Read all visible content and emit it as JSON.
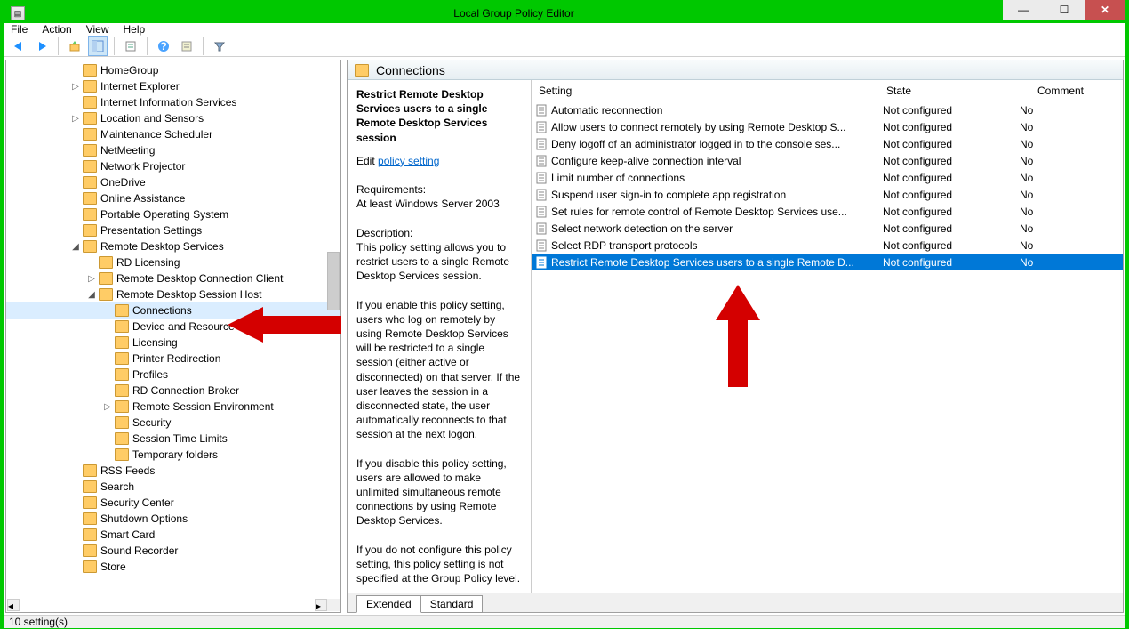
{
  "window": {
    "title": "Local Group Policy Editor"
  },
  "menu": {
    "file": "File",
    "action": "Action",
    "view": "View",
    "help": "Help"
  },
  "toolbar_icons": [
    "back-icon",
    "forward-icon",
    "up-icon",
    "show-hide-tree-icon",
    "export-list-icon",
    "help-icon",
    "properties-icon",
    "filter-icon"
  ],
  "header": {
    "title": "Connections"
  },
  "detail": {
    "title": "Restrict Remote Desktop Services users to a single Remote Desktop Services session",
    "edit_prefix": "Edit",
    "edit_link": "policy setting",
    "req_label": "Requirements:",
    "req_text": "At least Windows Server 2003",
    "desc_label": "Description:",
    "desc1": "This policy setting allows you to restrict users to a single Remote Desktop Services session.",
    "desc2": "If you enable this policy setting, users who log on remotely by using Remote Desktop Services will be restricted to a single session (either active or disconnected) on that server. If the user leaves the session in a disconnected state, the user automatically reconnects to that session at the next logon.",
    "desc3": "If you disable this policy setting, users are allowed to make unlimited simultaneous remote connections by using Remote Desktop Services.",
    "desc4": "If you do not configure this policy setting,  this policy setting is not specified at the Group Policy level."
  },
  "columns": {
    "setting": "Setting",
    "state": "State",
    "comment": "Comment"
  },
  "settings": [
    {
      "name": "Automatic reconnection",
      "state": "Not configured",
      "comment": "No"
    },
    {
      "name": "Allow users to connect remotely by using Remote Desktop S...",
      "state": "Not configured",
      "comment": "No"
    },
    {
      "name": "Deny logoff of an administrator logged in to the console ses...",
      "state": "Not configured",
      "comment": "No"
    },
    {
      "name": "Configure keep-alive connection interval",
      "state": "Not configured",
      "comment": "No"
    },
    {
      "name": "Limit number of connections",
      "state": "Not configured",
      "comment": "No"
    },
    {
      "name": "Suspend user sign-in to complete app registration",
      "state": "Not configured",
      "comment": "No"
    },
    {
      "name": "Set rules for remote control of Remote Desktop Services use...",
      "state": "Not configured",
      "comment": "No"
    },
    {
      "name": "Select network detection on the server",
      "state": "Not configured",
      "comment": "No"
    },
    {
      "name": "Select RDP transport protocols",
      "state": "Not configured",
      "comment": "No"
    },
    {
      "name": "Restrict Remote Desktop Services users to a single Remote D...",
      "state": "Not configured",
      "comment": "No",
      "selected": true
    }
  ],
  "tabs": {
    "extended": "Extended",
    "standard": "Standard"
  },
  "status": "10 setting(s)",
  "tree": [
    {
      "label": "HomeGroup",
      "indent": 4
    },
    {
      "label": "Internet Explorer",
      "indent": 4,
      "caret": "right"
    },
    {
      "label": "Internet Information Services",
      "indent": 4
    },
    {
      "label": "Location and Sensors",
      "indent": 4,
      "caret": "right"
    },
    {
      "label": "Maintenance Scheduler",
      "indent": 4
    },
    {
      "label": "NetMeeting",
      "indent": 4
    },
    {
      "label": "Network Projector",
      "indent": 4
    },
    {
      "label": "OneDrive",
      "indent": 4
    },
    {
      "label": "Online Assistance",
      "indent": 4
    },
    {
      "label": "Portable Operating System",
      "indent": 4
    },
    {
      "label": "Presentation Settings",
      "indent": 4
    },
    {
      "label": "Remote Desktop Services",
      "indent": 4,
      "caret": "down"
    },
    {
      "label": "RD Licensing",
      "indent": 5
    },
    {
      "label": "Remote Desktop Connection Client",
      "indent": 5,
      "caret": "right"
    },
    {
      "label": "Remote Desktop Session Host",
      "indent": 5,
      "caret": "down"
    },
    {
      "label": "Connections",
      "indent": 6,
      "sel": true
    },
    {
      "label": "Device and Resource Redirection",
      "indent": 6
    },
    {
      "label": "Licensing",
      "indent": 6
    },
    {
      "label": "Printer Redirection",
      "indent": 6
    },
    {
      "label": "Profiles",
      "indent": 6
    },
    {
      "label": "RD Connection Broker",
      "indent": 6
    },
    {
      "label": "Remote Session Environment",
      "indent": 6,
      "caret": "right"
    },
    {
      "label": "Security",
      "indent": 6
    },
    {
      "label": "Session Time Limits",
      "indent": 6
    },
    {
      "label": "Temporary folders",
      "indent": 6
    },
    {
      "label": "RSS Feeds",
      "indent": 4
    },
    {
      "label": "Search",
      "indent": 4
    },
    {
      "label": "Security Center",
      "indent": 4
    },
    {
      "label": "Shutdown Options",
      "indent": 4
    },
    {
      "label": "Smart Card",
      "indent": 4
    },
    {
      "label": "Sound Recorder",
      "indent": 4
    },
    {
      "label": "Store",
      "indent": 4
    }
  ]
}
